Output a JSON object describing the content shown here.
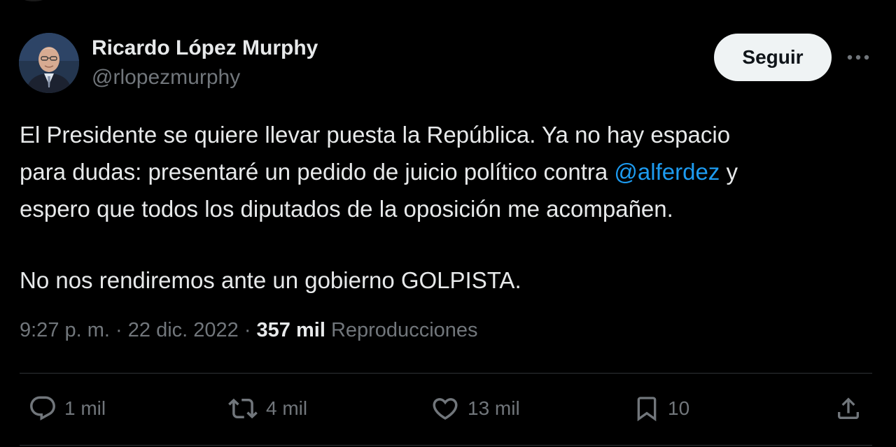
{
  "author": {
    "name": "Ricardo López Murphy",
    "handle": "@rlopezmurphy"
  },
  "follow_label": "Seguir",
  "tweet": {
    "text_line1_a": "El Presidente se quiere llevar puesta la República. Ya no hay espacio",
    "text_line2_a": "para dudas: presentaré un pedido de juicio político contra ",
    "mention": "@alferdez",
    "text_line2_b": " y",
    "text_line3": "espero que todos los diputados de la oposición me acompañen.",
    "text_para2": "No nos rendiremos ante un gobierno GOLPISTA."
  },
  "meta": {
    "time": "9:27 p. m.",
    "separator1": " · ",
    "date": "22 dic. 2022",
    "separator2": " · ",
    "views_count": "357 mil",
    "views_label": " Reproducciones"
  },
  "actions": {
    "replies": "1 mil",
    "retweets": "4 mil",
    "likes": "13 mil",
    "bookmarks": "10"
  },
  "icons": {
    "reply": "reply-icon",
    "retweet": "retweet-icon",
    "like": "heart-icon",
    "bookmark": "bookmark-icon",
    "share": "share-icon",
    "more": "more-dots-icon"
  },
  "colors": {
    "background": "#000000",
    "text": "#e7e9ea",
    "secondary": "#71767b",
    "link": "#1d9bf0",
    "follow_bg": "#eff3f4",
    "divider": "#2f3336"
  }
}
